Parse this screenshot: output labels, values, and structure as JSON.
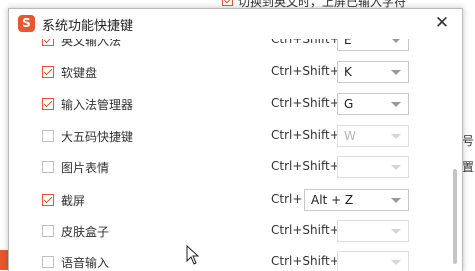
{
  "background_window": {
    "option_text": "切换到英文时，上屏已输入字符",
    "right_fragments": [
      "号",
      "置"
    ]
  },
  "dialog": {
    "title": "系统功能快捷键",
    "logo_glyph": "S",
    "close_glyph": "✕"
  },
  "shortcuts": [
    {
      "label": "英文输入法",
      "checked": true,
      "modifier": "Ctrl+Shift+",
      "key": "E",
      "enabled": true
    },
    {
      "label": "软键盘",
      "checked": true,
      "modifier": "Ctrl+Shift+",
      "key": "K",
      "enabled": true
    },
    {
      "label": "输入法管理器",
      "checked": true,
      "modifier": "Ctrl+Shift+",
      "key": "G",
      "enabled": true
    },
    {
      "label": "大五码快捷键",
      "checked": false,
      "modifier": "Ctrl+Shift+",
      "key": "W",
      "enabled": false
    },
    {
      "label": "图片表情",
      "checked": false,
      "modifier": "Ctrl+Shift+",
      "key": "",
      "enabled": false
    },
    {
      "label": "截屏",
      "checked": true,
      "modifier": "Ctrl+",
      "key": "Alt + Z",
      "enabled": true
    },
    {
      "label": "皮肤盒子",
      "checked": false,
      "modifier": "Ctrl+Shift+",
      "key": "",
      "enabled": false
    },
    {
      "label": "语音输入",
      "checked": false,
      "modifier": "Ctrl+Shift+",
      "key": "",
      "enabled": false
    }
  ],
  "colors": {
    "accent": "#e8572d",
    "checkbox_border": "#bfbfbf",
    "disabled_text": "#b5b5b5"
  }
}
